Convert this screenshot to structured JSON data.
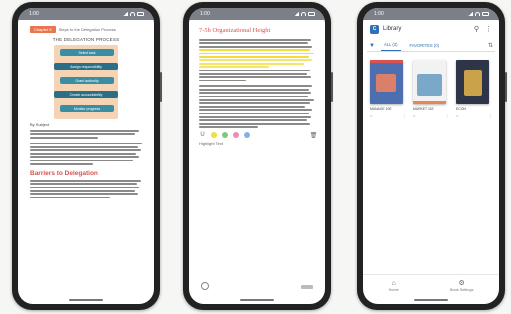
{
  "phones": [
    {
      "status_time": "1:00",
      "chapter_tag": "Chapter 5",
      "tag_text": "Steps to the Delegation Process",
      "diagram_title": "THE DELEGATION PROCESS",
      "steps": [
        "Select task",
        "Assign responsibility",
        "Grant authority",
        "Create accountability",
        "Monitor progress"
      ],
      "figure_caption": "By Subject",
      "heading": "Barriers to Delegation"
    },
    {
      "status_time": "1:00",
      "section_title": "7-5b Organizational Height",
      "toolbar_label": "Highlight Text"
    },
    {
      "status_time": "1:00",
      "app_logo": "C",
      "app_title": "Library",
      "tabs": [
        "ALL (3)",
        "FAVORITES (0)"
      ],
      "books": [
        {
          "title": "MANAGE 10E",
          "color": "#4d6fb0"
        },
        {
          "title": "MARKET 11E",
          "color": "#f2f2f2"
        },
        {
          "title": "ECON",
          "color": "#2e3548"
        }
      ],
      "bottom_nav": [
        {
          "label": "Home",
          "icon": "home-icon"
        },
        {
          "label": "Book Settings",
          "icon": "settings-icon"
        }
      ]
    }
  ],
  "colors": {
    "heading_red": "#d9534f",
    "highlight_yellow": "#f2dd3c",
    "brand_blue": "#2f6fb5"
  }
}
